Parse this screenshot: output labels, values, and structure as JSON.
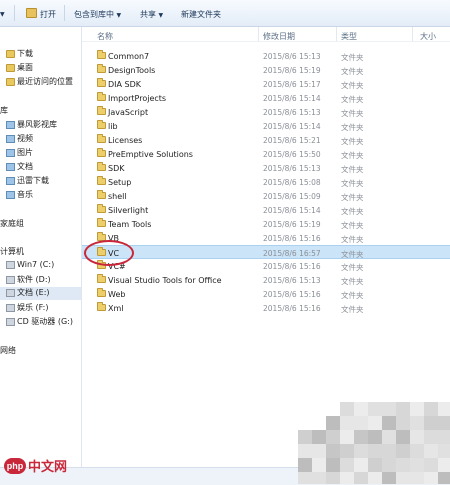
{
  "toolbar": {
    "open_label": "打开",
    "include_library_label": "包含到库中",
    "share_label": "共享",
    "new_folder_label": "新建文件夹"
  },
  "nav": {
    "items": [
      {
        "label": "下载",
        "icon": "folder"
      },
      {
        "label": "桌面",
        "icon": "folder"
      },
      {
        "label": "最近访问的位置",
        "icon": "folder"
      },
      {
        "label": "库",
        "icon": "none"
      },
      {
        "label": "暴风影视库",
        "icon": "lib"
      },
      {
        "label": "视频",
        "icon": "lib"
      },
      {
        "label": "图片",
        "icon": "lib"
      },
      {
        "label": "文档",
        "icon": "lib"
      },
      {
        "label": "迅雷下载",
        "icon": "lib"
      },
      {
        "label": "音乐",
        "icon": "lib"
      },
      {
        "label": "家庭组",
        "icon": "none"
      },
      {
        "label": "计算机",
        "icon": "none"
      },
      {
        "label": "Win7 (C:)",
        "icon": "drive"
      },
      {
        "label": "软件 (D:)",
        "icon": "drive"
      },
      {
        "label": "文档 (E:)",
        "icon": "drive"
      },
      {
        "label": "娱乐 (F:)",
        "icon": "drive"
      },
      {
        "label": "CD 驱动器 (G:)",
        "icon": "drive"
      },
      {
        "label": "网络",
        "icon": "none"
      }
    ]
  },
  "columns": {
    "name": "名称",
    "date": "修改日期",
    "type": "类型",
    "size": "大小"
  },
  "files": [
    {
      "name": "Common7",
      "date": "2015/8/6 15:13",
      "type": "文件夹"
    },
    {
      "name": "DesignTools",
      "date": "2015/8/6 15:19",
      "type": "文件夹"
    },
    {
      "name": "DIA SDK",
      "date": "2015/8/6 15:17",
      "type": "文件夹"
    },
    {
      "name": "ImportProjects",
      "date": "2015/8/6 15:14",
      "type": "文件夹"
    },
    {
      "name": "JavaScript",
      "date": "2015/8/6 15:13",
      "type": "文件夹"
    },
    {
      "name": "lib",
      "date": "2015/8/6 15:14",
      "type": "文件夹"
    },
    {
      "name": "Licenses",
      "date": "2015/8/6 15:21",
      "type": "文件夹"
    },
    {
      "name": "PreEmptive Solutions",
      "date": "2015/8/6 15:50",
      "type": "文件夹"
    },
    {
      "name": "SDK",
      "date": "2015/8/6 15:13",
      "type": "文件夹"
    },
    {
      "name": "Setup",
      "date": "2015/8/6 15:08",
      "type": "文件夹"
    },
    {
      "name": "shell",
      "date": "2015/8/6 15:09",
      "type": "文件夹"
    },
    {
      "name": "Silverlight",
      "date": "2015/8/6 15:14",
      "type": "文件夹"
    },
    {
      "name": "Team Tools",
      "date": "2015/8/6 15:19",
      "type": "文件夹"
    },
    {
      "name": "VB",
      "date": "2015/8/6 15:16",
      "type": "文件夹"
    },
    {
      "name": "VC",
      "date": "2015/8/6 16:57",
      "type": "文件夹",
      "selected": true
    },
    {
      "name": "VC#",
      "date": "2015/8/6 15:16",
      "type": "文件夹"
    },
    {
      "name": "Visual Studio Tools for Office",
      "date": "2015/8/6 15:13",
      "type": "文件夹"
    },
    {
      "name": "Web",
      "date": "2015/8/6 15:16",
      "type": "文件夹"
    },
    {
      "name": "Xml",
      "date": "2015/8/6 15:16",
      "type": "文件夹"
    }
  ],
  "watermark": {
    "logo_text": "php",
    "site_text": "中文网"
  },
  "colors": {
    "selection": "#cce4f7",
    "annotation_ring": "#c8283a",
    "folder": "#eccf6b"
  }
}
